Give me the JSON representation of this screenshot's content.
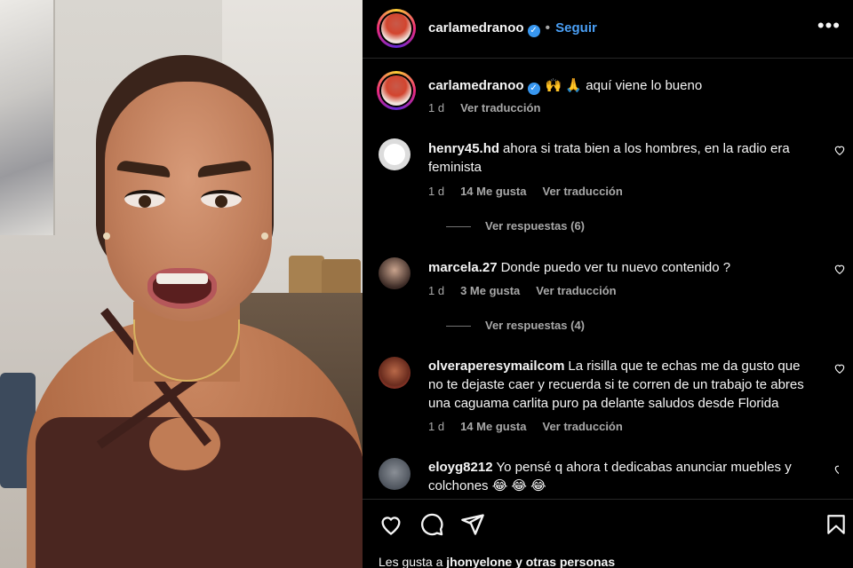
{
  "post": {
    "username": "carlamedranoo",
    "follow_label": "Seguir",
    "caption_text": "🙌 🙏 aquí viene lo bueno",
    "caption_time": "1 d",
    "caption_translate": "Ver traducción"
  },
  "comments": [
    {
      "username": "henry45.hd",
      "text": "ahora si trata bien a los hombres, en la radio era feminista",
      "time": "1 d",
      "likes": "14 Me gusta",
      "translate": "Ver traducción",
      "replies": "Ver respuestas (6)"
    },
    {
      "username": "marcela.27",
      "text": "Donde puedo ver tu nuevo contenido ?",
      "time": "1 d",
      "likes": "3 Me gusta",
      "translate": "Ver traducción",
      "replies": "Ver respuestas (4)"
    },
    {
      "username": "olveraperesymailcom",
      "text": "La risilla que te echas me da gusto que no te dejaste caer y recuerda si te corren de un trabajo te abres una caguama carlita puro pa delante saludos desde Florida",
      "time": "1 d",
      "likes": "14 Me gusta",
      "translate": "Ver traducción"
    },
    {
      "username": "eloyg8212",
      "text": "Yo pensé q ahora t dedicabas anunciar muebles y colchones 😂 😂 😂"
    }
  ],
  "footer": {
    "likes_prefix": "Les gusta a",
    "likes_user": "jhonyelone",
    "likes_suffix": "y otras personas"
  },
  "icons": {
    "more": "more-horizontal-icon",
    "verified": "verified-badge-icon",
    "like": "heart-icon",
    "comment": "comment-icon",
    "share": "send-icon",
    "save": "bookmark-icon"
  },
  "colors": {
    "accent": "#4a9ff5",
    "background": "#000000",
    "muted": "#a8a8a8"
  }
}
